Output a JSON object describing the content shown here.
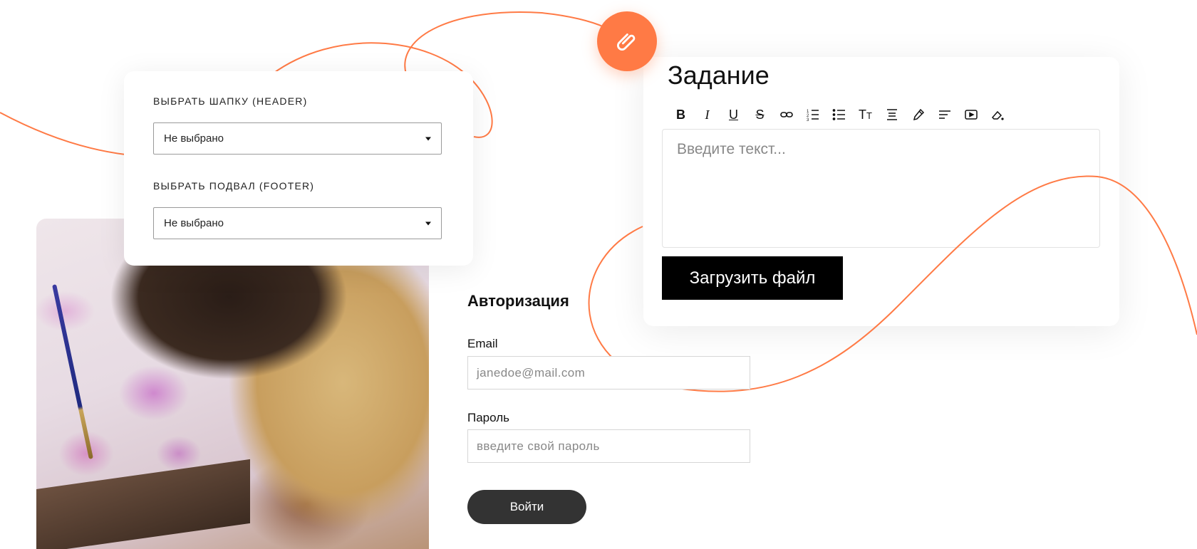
{
  "colors": {
    "accent": "#ff7a45",
    "button_dark": "#000000",
    "login_button": "#333333"
  },
  "page_builder": {
    "header_label": "ВЫБРАТЬ ШАПКУ (HEADER)",
    "header_value": "Не выбрано",
    "footer_label": "ВЫБРАТЬ ПОДВАЛ (FOOTER)",
    "footer_value": "Не выбрано"
  },
  "editor": {
    "badge_icon": "paperclip-icon",
    "title": "Задание",
    "toolbar": [
      {
        "name": "bold-button",
        "icon": "bold-icon"
      },
      {
        "name": "italic-button",
        "icon": "italic-icon"
      },
      {
        "name": "underline-button",
        "icon": "underline-icon"
      },
      {
        "name": "strikethrough-button",
        "icon": "strikethrough-icon"
      },
      {
        "name": "link-button",
        "icon": "link-icon"
      },
      {
        "name": "ordered-list-button",
        "icon": "ordered-list-icon"
      },
      {
        "name": "bullet-list-button",
        "icon": "bullet-list-icon"
      },
      {
        "name": "text-size-button",
        "icon": "text-size-icon"
      },
      {
        "name": "line-height-button",
        "icon": "line-height-icon"
      },
      {
        "name": "color-picker-button",
        "icon": "eyedropper-icon"
      },
      {
        "name": "align-button",
        "icon": "align-left-icon"
      },
      {
        "name": "video-button",
        "icon": "video-icon"
      },
      {
        "name": "clear-format-button",
        "icon": "eraser-icon"
      }
    ],
    "placeholder": "Введите текст...",
    "upload_label": "Загрузить файл"
  },
  "auth": {
    "title": "Авторизация",
    "email_label": "Email",
    "email_placeholder": "janedoe@mail.com",
    "password_label": "Пароль",
    "password_placeholder": "введите свой пароль",
    "login_label": "Войти"
  }
}
